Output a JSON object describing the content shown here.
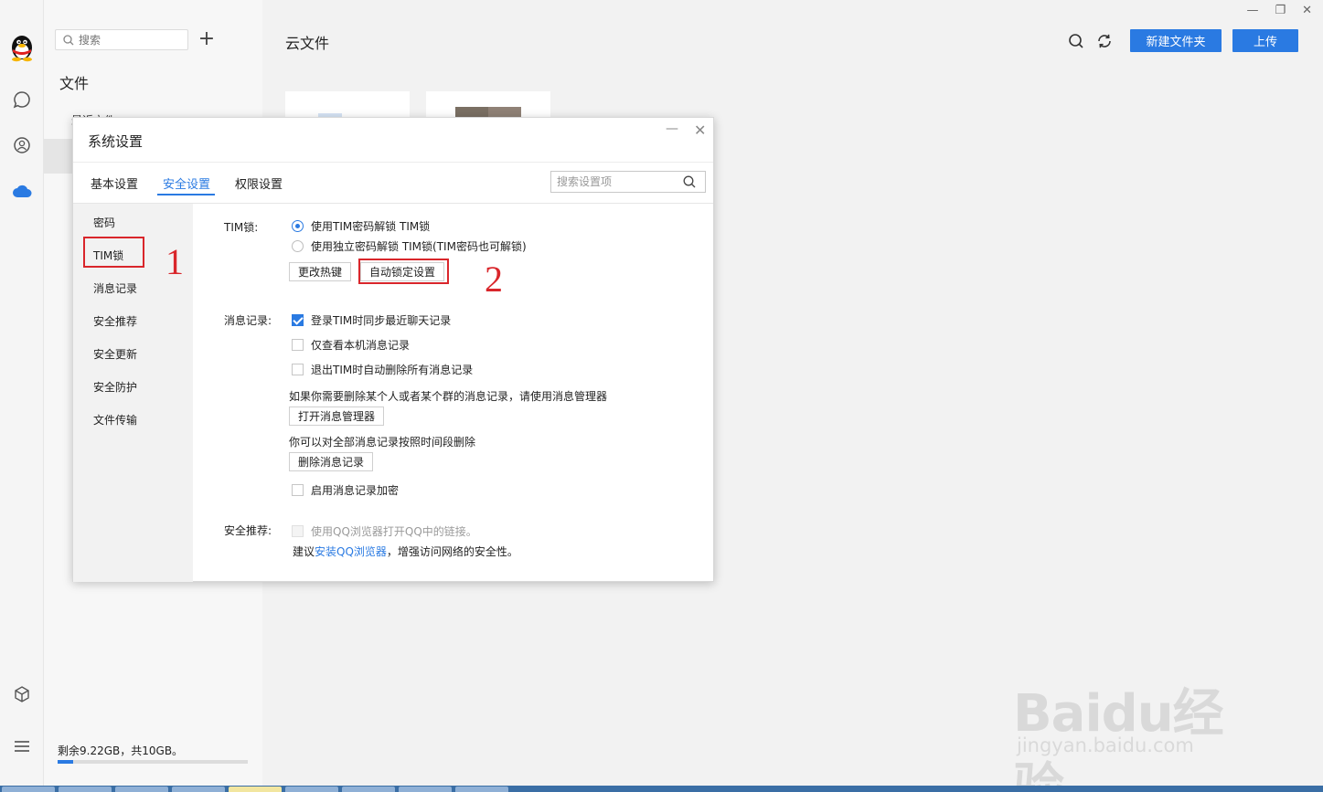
{
  "app": {
    "search_placeholder": "搜索",
    "add_label": "+",
    "section_title": "文件",
    "hidden_item": "最近文件",
    "storage_text": "剩余9.22GB，共10GB。",
    "storage_used_fraction": 0.08
  },
  "main": {
    "title": "云文件",
    "new_folder_label": "新建文件夹",
    "upload_label": "上传",
    "window_controls": {
      "minimize": "—",
      "restore": "❐",
      "close": "✕"
    }
  },
  "dialog": {
    "title": "系统设置",
    "minimize": "—",
    "close": "✕",
    "tabs": [
      {
        "label": "基本设置",
        "active": false
      },
      {
        "label": "安全设置",
        "active": true
      },
      {
        "label": "权限设置",
        "active": false
      }
    ],
    "search_placeholder": "搜索设置项",
    "categories": [
      {
        "label": "密码"
      },
      {
        "label": "TIM锁"
      },
      {
        "label": "消息记录"
      },
      {
        "label": "安全推荐"
      },
      {
        "label": "安全更新"
      },
      {
        "label": "安全防护"
      },
      {
        "label": "文件传输"
      }
    ],
    "tim_lock": {
      "label": "TIM锁:",
      "option1": "使用TIM密码解锁 TIM锁",
      "option2": "使用独立密码解锁 TIM锁(TIM密码也可解锁)",
      "hotkey_button": "更改热键",
      "auto_lock_button": "自动锁定设置"
    },
    "message_record": {
      "label": "消息记录:",
      "option1": "登录TIM时同步最近聊天记录",
      "option2": "仅查看本机消息记录",
      "option3": "退出TIM时自动删除所有消息记录",
      "hint1": "如果你需要删除某个人或者某个群的消息记录，请使用消息管理器",
      "open_manager_button": "打开消息管理器",
      "hint2": "你可以对全部消息记录按照时间段删除",
      "delete_button": "删除消息记录",
      "encrypt_option": "启用消息记录加密"
    },
    "security_recommend": {
      "label": "安全推荐:",
      "option": "使用QQ浏览器打开QQ中的链接。",
      "tip_prefix": "建议",
      "tip_link": "安装QQ浏览器",
      "tip_suffix": "，增强访问网络的安全性。"
    }
  },
  "annotations": {
    "one": "1",
    "two": "2"
  },
  "watermark": {
    "brand": "Baidu经验",
    "url": "jingyan.baidu.com"
  },
  "colors": {
    "accent": "#2a7ae2",
    "annotation": "#d9262b"
  }
}
